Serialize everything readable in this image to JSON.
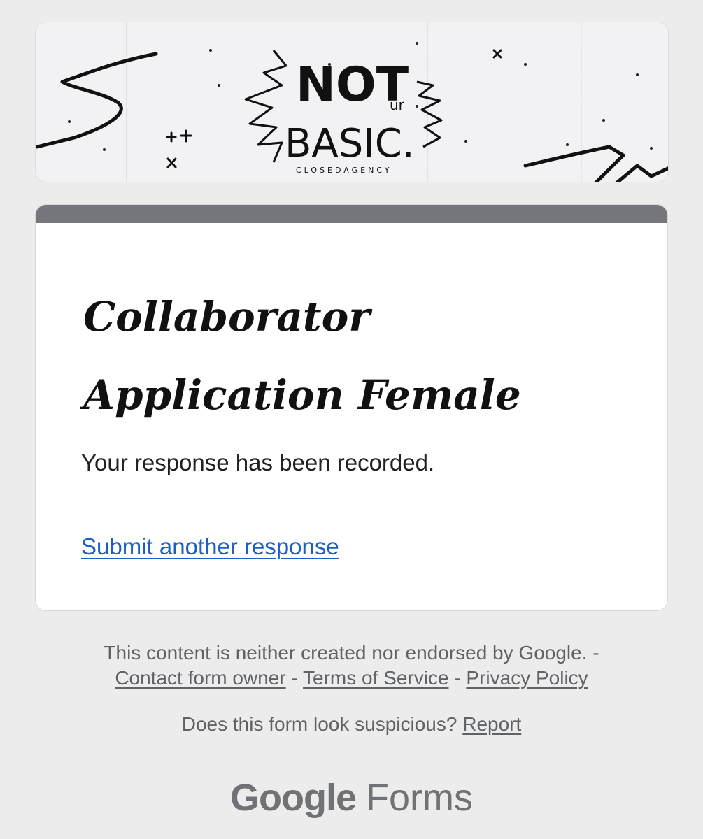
{
  "header": {
    "logo_word_1": "NOT",
    "logo_word_small": "ur",
    "logo_word_2": "BASIC.",
    "logo_subtitle": "CLOSEDAGENCY"
  },
  "form": {
    "title": "Collaborator Application Female",
    "confirmation_text": "Your response has been recorded.",
    "submit_another_label": "Submit another response",
    "accent_color": "#75777c"
  },
  "footer": {
    "disclaimer_text": "This content is neither created nor endorsed by Google. -",
    "contact_label": "Contact form owner",
    "separator": "-",
    "terms_label": "Terms of Service",
    "privacy_label": "Privacy Policy",
    "suspicious_text": "Does this form look suspicious?",
    "report_label": "Report",
    "logo_google": "Google",
    "logo_forms": "Forms"
  },
  "colors": {
    "link": "#1a5fc6",
    "page_background": "#ececec",
    "footer_text": "#5f6368"
  }
}
